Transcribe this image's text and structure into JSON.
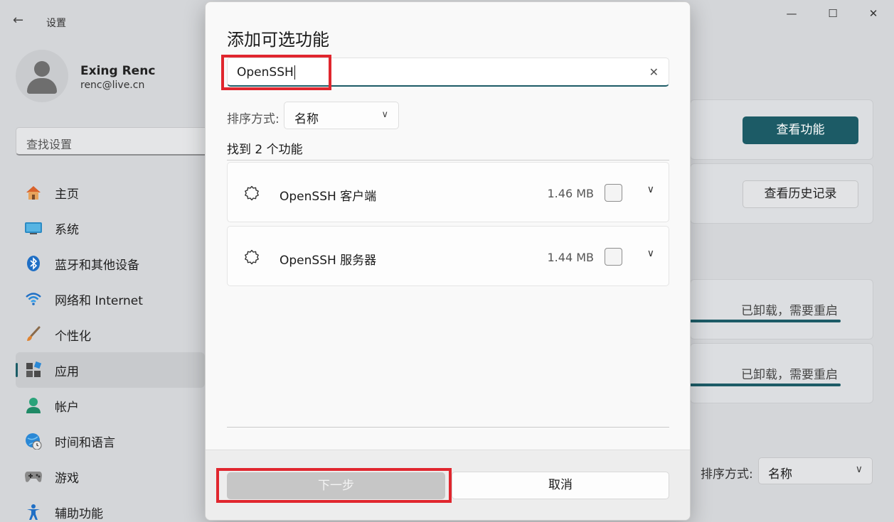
{
  "window": {
    "back_icon": "←",
    "title": "设置",
    "minimize_icon": "—",
    "maximize_icon": "☐",
    "close_icon": "✕"
  },
  "profile": {
    "name": "Exing Renc",
    "email": "renc@live.cn"
  },
  "search": {
    "placeholder": "查找设置"
  },
  "sidebar": {
    "items": [
      {
        "label": "主页",
        "icon": "home-icon",
        "active": false
      },
      {
        "label": "系统",
        "icon": "system-icon",
        "active": false
      },
      {
        "label": "蓝牙和其他设备",
        "icon": "bluetooth-icon",
        "active": false
      },
      {
        "label": "网络和 Internet",
        "icon": "wifi-icon",
        "active": false
      },
      {
        "label": "个性化",
        "icon": "brush-icon",
        "active": false
      },
      {
        "label": "应用",
        "icon": "apps-icon",
        "active": true
      },
      {
        "label": "帐户",
        "icon": "account-icon",
        "active": false
      },
      {
        "label": "时间和语言",
        "icon": "globe-clock-icon",
        "active": false
      },
      {
        "label": "游戏",
        "icon": "gamepad-icon",
        "active": false
      },
      {
        "label": "辅助功能",
        "icon": "accessibility-icon",
        "active": false
      }
    ]
  },
  "background": {
    "view_features_button": "查看功能",
    "view_history_button": "查看历史记录",
    "status_1": "已卸载，需要重启",
    "status_2": "已卸载，需要重启",
    "sort_label": "排序方式:",
    "sort_value": "名称"
  },
  "dialog": {
    "title": "添加可选功能",
    "search_value": "OpenSSH",
    "clear_icon": "✕",
    "sort_label": "排序方式:",
    "sort_value": "名称",
    "found_text": "找到 2 个功能",
    "features": [
      {
        "name": "OpenSSH 客户端",
        "size": "1.46 MB",
        "checked": false
      },
      {
        "name": "OpenSSH 服务器",
        "size": "1.44 MB",
        "checked": false
      }
    ],
    "next_button": "下一步",
    "cancel_button": "取消"
  },
  "colors": {
    "accent": "#1c5b66",
    "highlight": "#e0262e",
    "disabled_button": "#c6c6c6"
  }
}
